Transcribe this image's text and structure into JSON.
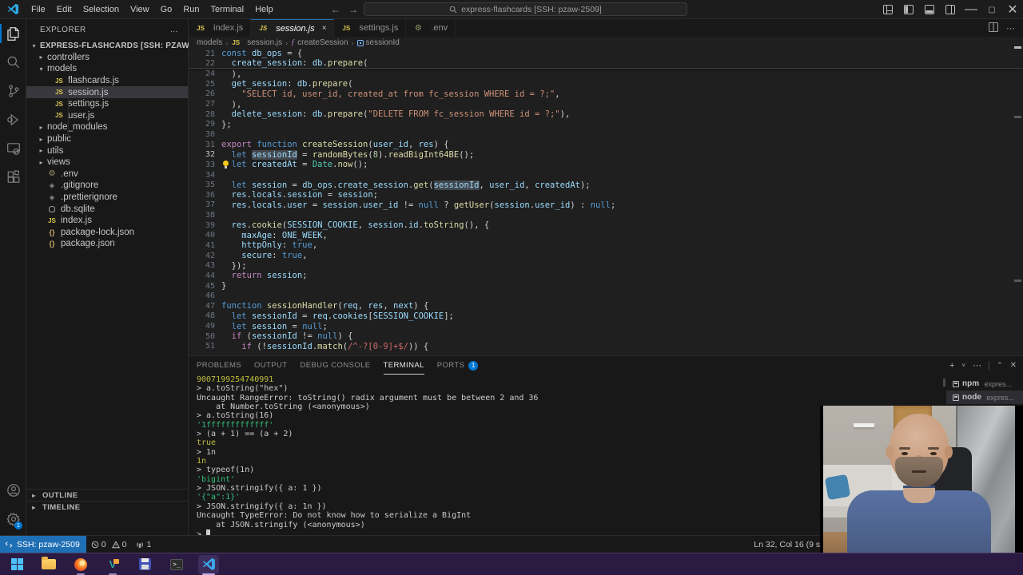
{
  "window": {
    "menus": [
      "File",
      "Edit",
      "Selection",
      "View",
      "Go",
      "Run",
      "Terminal",
      "Help"
    ],
    "search_text": "express-flashcards [SSH: pzaw-2509]",
    "controls": [
      "minimize",
      "maximize",
      "close"
    ]
  },
  "activity_bar": {
    "items": [
      "explorer",
      "search",
      "source-control",
      "run-debug",
      "remote-explorer",
      "extensions"
    ],
    "bottom": [
      "account",
      "settings"
    ],
    "settings_badge": "1"
  },
  "explorer": {
    "header": "EXPLORER",
    "more_label": "…",
    "tree": [
      {
        "label": "EXPRESS-FLASHCARDS [SSH: PZAW-2509]",
        "lvl": 0,
        "chev": "down",
        "icon": null,
        "selected": false,
        "bold": true
      },
      {
        "label": "controllers",
        "lvl": 1,
        "chev": "right",
        "icon": null,
        "selected": false
      },
      {
        "label": "models",
        "lvl": 1,
        "chev": "down",
        "icon": null,
        "selected": false
      },
      {
        "label": "flashcards.js",
        "lvl": 2,
        "chev": null,
        "icon": "js",
        "selected": false
      },
      {
        "label": "session.js",
        "lvl": 2,
        "chev": null,
        "icon": "js",
        "selected": true
      },
      {
        "label": "settings.js",
        "lvl": 2,
        "chev": null,
        "icon": "js",
        "selected": false
      },
      {
        "label": "user.js",
        "lvl": 2,
        "chev": null,
        "icon": "js",
        "selected": false
      },
      {
        "label": "node_modules",
        "lvl": 1,
        "chev": "right",
        "icon": null,
        "selected": false
      },
      {
        "label": "public",
        "lvl": 1,
        "chev": "right",
        "icon": null,
        "selected": false
      },
      {
        "label": "utils",
        "lvl": 1,
        "chev": "right",
        "icon": null,
        "selected": false
      },
      {
        "label": "views",
        "lvl": 1,
        "chev": "right",
        "icon": null,
        "selected": false
      },
      {
        "label": ".env",
        "lvl": 1,
        "chev": null,
        "icon": "gear",
        "selected": false
      },
      {
        "label": ".gitignore",
        "lvl": 1,
        "chev": null,
        "icon": "diamond",
        "selected": false
      },
      {
        "label": ".prettierignore",
        "lvl": 1,
        "chev": null,
        "icon": "diamond",
        "selected": false
      },
      {
        "label": "db.sqlite",
        "lvl": 1,
        "chev": null,
        "icon": "db",
        "selected": false
      },
      {
        "label": "index.js",
        "lvl": 1,
        "chev": null,
        "icon": "js",
        "selected": false
      },
      {
        "label": "package-lock.json",
        "lvl": 1,
        "chev": null,
        "icon": "braces",
        "selected": false
      },
      {
        "label": "package.json",
        "lvl": 1,
        "chev": null,
        "icon": "braces",
        "selected": false
      }
    ],
    "sections": [
      "OUTLINE",
      "TIMELINE"
    ]
  },
  "tabs": [
    {
      "label": "index.js",
      "icon": "js",
      "active": false
    },
    {
      "label": "session.js",
      "icon": "js",
      "active": true,
      "close": "×"
    },
    {
      "label": "settings.js",
      "icon": "js",
      "active": false
    },
    {
      "label": ".env",
      "icon": "gear",
      "active": false
    }
  ],
  "breadcrumb": [
    {
      "label": "models",
      "icon": null
    },
    {
      "label": "session.js",
      "icon": "js"
    },
    {
      "label": "createSession",
      "icon": "method"
    },
    {
      "label": "sessionId",
      "icon": "variable"
    }
  ],
  "editor": {
    "lines": [
      {
        "n": "21",
        "t": [
          [
            "k",
            "const "
          ],
          [
            "v",
            "db_ops"
          ],
          [
            "p",
            " = {"
          ]
        ]
      },
      {
        "n": "22",
        "t": [
          [
            "p",
            "  "
          ],
          [
            "v",
            "create_session"
          ],
          [
            "p",
            ": "
          ],
          [
            "v",
            "db"
          ],
          [
            "p",
            "."
          ],
          [
            "f",
            "prepare"
          ],
          [
            "p",
            "("
          ]
        ],
        "sep": true
      },
      {
        "n": "24",
        "t": [
          [
            "p",
            "  ),"
          ]
        ]
      },
      {
        "n": "25",
        "t": [
          [
            "p",
            "  "
          ],
          [
            "v",
            "get_session"
          ],
          [
            "p",
            ": "
          ],
          [
            "v",
            "db"
          ],
          [
            "p",
            "."
          ],
          [
            "f",
            "prepare"
          ],
          [
            "p",
            "("
          ]
        ]
      },
      {
        "n": "26",
        "t": [
          [
            "p",
            "    "
          ],
          [
            "s",
            "\"SELECT id, user_id, created_at from fc_session WHERE id = ?;\""
          ],
          [
            "p",
            ","
          ]
        ]
      },
      {
        "n": "27",
        "t": [
          [
            "p",
            "  ),"
          ]
        ]
      },
      {
        "n": "28",
        "t": [
          [
            "p",
            "  "
          ],
          [
            "v",
            "delete_session"
          ],
          [
            "p",
            ": "
          ],
          [
            "v",
            "db"
          ],
          [
            "p",
            "."
          ],
          [
            "f",
            "prepare"
          ],
          [
            "p",
            "("
          ],
          [
            "s",
            "\"DELETE FROM fc_session WHERE id = ?;\""
          ],
          [
            "p",
            "),"
          ]
        ]
      },
      {
        "n": "29",
        "t": [
          [
            "p",
            "};"
          ]
        ]
      },
      {
        "n": "30",
        "t": []
      },
      {
        "n": "31",
        "t": [
          [
            "c",
            "export "
          ],
          [
            "k",
            "function "
          ],
          [
            "f",
            "createSession"
          ],
          [
            "p",
            "("
          ],
          [
            "v",
            "user_id"
          ],
          [
            "p",
            ", "
          ],
          [
            "v",
            "res"
          ],
          [
            "p",
            ") {"
          ]
        ]
      },
      {
        "n": "32",
        "active": true,
        "t": [
          [
            "p",
            "  "
          ],
          [
            "k",
            "let "
          ],
          [
            "v sel",
            "sessionId"
          ],
          [
            "p",
            " = "
          ],
          [
            "f",
            "randomBytes"
          ],
          [
            "p",
            "("
          ],
          [
            "n",
            "8"
          ],
          [
            "p",
            ")."
          ],
          [
            "f",
            "readBigInt64BE"
          ],
          [
            "p",
            "();"
          ]
        ]
      },
      {
        "n": "33",
        "bulb": true,
        "t": [
          [
            "p",
            "  "
          ],
          [
            "k",
            "let "
          ],
          [
            "v",
            "createdAt"
          ],
          [
            "p",
            " = "
          ],
          [
            "t",
            "Date"
          ],
          [
            "p",
            "."
          ],
          [
            "f",
            "now"
          ],
          [
            "p",
            "();"
          ]
        ]
      },
      {
        "n": "34",
        "t": []
      },
      {
        "n": "35",
        "t": [
          [
            "p",
            "  "
          ],
          [
            "k",
            "let "
          ],
          [
            "v",
            "session"
          ],
          [
            "p",
            " = "
          ],
          [
            "v",
            "db_ops"
          ],
          [
            "p",
            "."
          ],
          [
            "v",
            "create_session"
          ],
          [
            "p",
            "."
          ],
          [
            "f",
            "get"
          ],
          [
            "p",
            "("
          ],
          [
            "v sel",
            "sessionId"
          ],
          [
            "p",
            ", "
          ],
          [
            "v",
            "user_id"
          ],
          [
            "p",
            ", "
          ],
          [
            "v",
            "createdAt"
          ],
          [
            "p",
            ");"
          ]
        ]
      },
      {
        "n": "36",
        "t": [
          [
            "p",
            "  "
          ],
          [
            "v",
            "res"
          ],
          [
            "p",
            "."
          ],
          [
            "v",
            "locals"
          ],
          [
            "p",
            "."
          ],
          [
            "v",
            "session"
          ],
          [
            "p",
            " = "
          ],
          [
            "v",
            "session"
          ],
          [
            "p",
            ";"
          ]
        ]
      },
      {
        "n": "37",
        "t": [
          [
            "p",
            "  "
          ],
          [
            "v",
            "res"
          ],
          [
            "p",
            "."
          ],
          [
            "v",
            "locals"
          ],
          [
            "p",
            "."
          ],
          [
            "v",
            "user"
          ],
          [
            "p",
            " = "
          ],
          [
            "v",
            "session"
          ],
          [
            "p",
            "."
          ],
          [
            "v",
            "user_id"
          ],
          [
            "p",
            " != "
          ],
          [
            "k",
            "null"
          ],
          [
            "p",
            " ? "
          ],
          [
            "f",
            "getUser"
          ],
          [
            "p",
            "("
          ],
          [
            "v",
            "session"
          ],
          [
            "p",
            "."
          ],
          [
            "v",
            "user_id"
          ],
          [
            "p",
            ") : "
          ],
          [
            "k",
            "null"
          ],
          [
            "p",
            ";"
          ]
        ]
      },
      {
        "n": "38",
        "t": []
      },
      {
        "n": "39",
        "t": [
          [
            "p",
            "  "
          ],
          [
            "v",
            "res"
          ],
          [
            "p",
            "."
          ],
          [
            "f",
            "cookie"
          ],
          [
            "p",
            "("
          ],
          [
            "v",
            "SESSION_COOKIE"
          ],
          [
            "p",
            ", "
          ],
          [
            "v",
            "session"
          ],
          [
            "p",
            "."
          ],
          [
            "v",
            "id"
          ],
          [
            "p",
            "."
          ],
          [
            "f",
            "toString"
          ],
          [
            "p",
            "(), {"
          ]
        ]
      },
      {
        "n": "40",
        "t": [
          [
            "p",
            "    "
          ],
          [
            "v",
            "maxAge"
          ],
          [
            "p",
            ": "
          ],
          [
            "v",
            "ONE_WEEK"
          ],
          [
            "p",
            ","
          ]
        ]
      },
      {
        "n": "41",
        "t": [
          [
            "p",
            "    "
          ],
          [
            "v",
            "httpOnly"
          ],
          [
            "p",
            ": "
          ],
          [
            "k",
            "true"
          ],
          [
            "p",
            ","
          ]
        ]
      },
      {
        "n": "42",
        "t": [
          [
            "p",
            "    "
          ],
          [
            "v",
            "secure"
          ],
          [
            "p",
            ": "
          ],
          [
            "k",
            "true"
          ],
          [
            "p",
            ","
          ]
        ]
      },
      {
        "n": "43",
        "t": [
          [
            "p",
            "  });"
          ]
        ]
      },
      {
        "n": "44",
        "t": [
          [
            "p",
            "  "
          ],
          [
            "c",
            "return "
          ],
          [
            "v",
            "session"
          ],
          [
            "p",
            ";"
          ]
        ]
      },
      {
        "n": "45",
        "t": [
          [
            "p",
            "}"
          ]
        ]
      },
      {
        "n": "46",
        "t": []
      },
      {
        "n": "47",
        "t": [
          [
            "k",
            "function "
          ],
          [
            "f",
            "sessionHandler"
          ],
          [
            "p",
            "("
          ],
          [
            "v",
            "req"
          ],
          [
            "p",
            ", "
          ],
          [
            "v",
            "res"
          ],
          [
            "p",
            ", "
          ],
          [
            "v",
            "next"
          ],
          [
            "p",
            ") {"
          ]
        ]
      },
      {
        "n": "48",
        "t": [
          [
            "p",
            "  "
          ],
          [
            "k",
            "let "
          ],
          [
            "v",
            "sessionId"
          ],
          [
            "p",
            " = "
          ],
          [
            "v",
            "req"
          ],
          [
            "p",
            "."
          ],
          [
            "v",
            "cookies"
          ],
          [
            "p",
            "["
          ],
          [
            "v",
            "SESSION_COOKIE"
          ],
          [
            "p",
            "];"
          ]
        ]
      },
      {
        "n": "49",
        "t": [
          [
            "p",
            "  "
          ],
          [
            "k",
            "let "
          ],
          [
            "v",
            "session"
          ],
          [
            "p",
            " = "
          ],
          [
            "k",
            "null"
          ],
          [
            "p",
            ";"
          ]
        ]
      },
      {
        "n": "50",
        "t": [
          [
            "p",
            "  "
          ],
          [
            "c",
            "if "
          ],
          [
            "p",
            "("
          ],
          [
            "v",
            "sessionId"
          ],
          [
            "p",
            " != "
          ],
          [
            "k",
            "null"
          ],
          [
            "p",
            ") {"
          ]
        ]
      },
      {
        "n": "51",
        "t": [
          [
            "p",
            "    "
          ],
          [
            "c",
            "if "
          ],
          [
            "p",
            "(!"
          ],
          [
            "v",
            "sessionId"
          ],
          [
            "p",
            "."
          ],
          [
            "f",
            "match"
          ],
          [
            "p",
            "("
          ],
          [
            "r",
            "/^-?[0-9]+$/"
          ],
          [
            "p",
            ")) {"
          ]
        ]
      }
    ]
  },
  "panel": {
    "tabs": [
      {
        "label": "PROBLEMS",
        "active": false
      },
      {
        "label": "OUTPUT",
        "active": false
      },
      {
        "label": "DEBUG CONSOLE",
        "active": false
      },
      {
        "label": "TERMINAL",
        "active": true
      },
      {
        "label": "PORTS",
        "active": false,
        "badge": "1"
      }
    ],
    "terminals": [
      {
        "label": "npm",
        "detail": "expres...",
        "selected": false
      },
      {
        "label": "node",
        "detail": "expres...",
        "selected": true
      }
    ],
    "lines": [
      {
        "c": "y",
        "t": "9007199254740991"
      },
      {
        "c": "w",
        "t": "> a.toString(\"hex\")"
      },
      {
        "c": "w",
        "t": "Uncaught RangeError: toString() radix argument must be between 2 and 36"
      },
      {
        "c": "w",
        "t": "    at Number.toString (<anonymous>)"
      },
      {
        "c": "w",
        "t": "> a.toString(16)"
      },
      {
        "c": "g",
        "t": "'1fffffffffffff'"
      },
      {
        "c": "w",
        "t": "> (a + 1) == (a + 2)"
      },
      {
        "c": "y",
        "t": "true"
      },
      {
        "c": "w",
        "t": "> 1n"
      },
      {
        "c": "y",
        "t": "1n"
      },
      {
        "c": "w",
        "t": "> typeof(1n)"
      },
      {
        "c": "g",
        "t": "'bigint'"
      },
      {
        "c": "w",
        "t": "> JSON.stringify({ a: 1 })"
      },
      {
        "c": "g",
        "t": "'{\"a\":1}'"
      },
      {
        "c": "w",
        "t": "> JSON.stringify({ a: 1n })"
      },
      {
        "c": "w",
        "t": "Uncaught TypeError: Do not know how to serialize a BigInt"
      },
      {
        "c": "w",
        "t": "    at JSON.stringify (<anonymous>)"
      },
      {
        "c": "w",
        "t": "> ",
        "cursor": true
      }
    ]
  },
  "status_bar": {
    "remote": "SSH: pzaw-2509",
    "errors": "0",
    "warnings": "0",
    "ports": "1",
    "cursor": "Ln 32, Col 16 (9 se"
  },
  "taskbar": {
    "items": [
      {
        "name": "start",
        "running": false
      },
      {
        "name": "file-explorer",
        "running": false
      },
      {
        "name": "firefox",
        "running": true
      },
      {
        "name": "security-app",
        "running": true
      },
      {
        "name": "save-app",
        "running": false
      },
      {
        "name": "terminal-app",
        "running": false
      },
      {
        "name": "vscode",
        "running": true,
        "active": true
      }
    ]
  },
  "colors": {
    "accent": "#0078d4",
    "remote_badge": "#1f6fb5",
    "editor_bg": "#1f1f1f",
    "chrome_bg": "#181818",
    "taskbar_bg": "#2b1b42",
    "term_number": "#bdbd3d",
    "term_string": "#35be7c"
  }
}
